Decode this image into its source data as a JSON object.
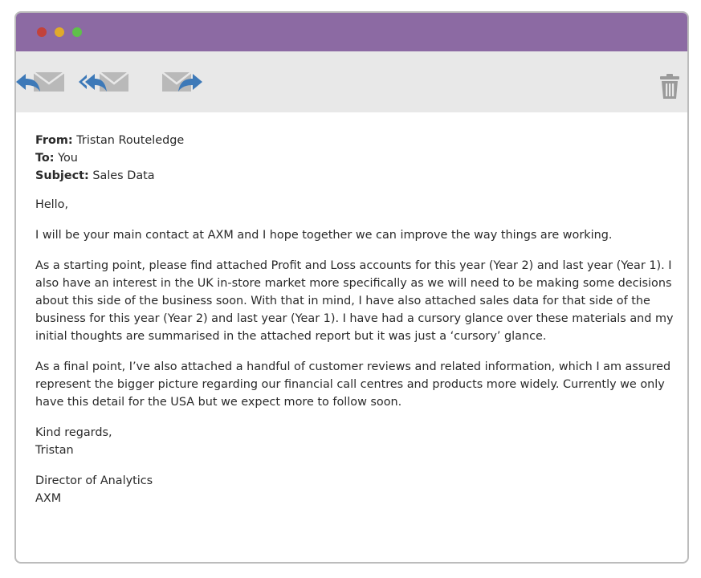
{
  "window": {
    "controls": {
      "close_color": "#c2423b",
      "minimize_color": "#e0aa2b",
      "maximize_color": "#5fc04b"
    },
    "titlebar_color": "#8c6aa3"
  },
  "toolbar": {
    "icons": {
      "reply": "reply-icon",
      "reply_all": "reply-all-icon",
      "forward": "forward-icon",
      "trash": "trash-icon"
    },
    "icon_accent": "#3d79b8",
    "envelope_color": "#b9b9b9"
  },
  "email": {
    "from_label": "From:",
    "from_value": "Tristan Routeledge",
    "to_label": "To:",
    "to_value": "You",
    "subject_label": "Subject:",
    "subject_value": "Sales Data",
    "greeting": "Hello,",
    "paragraphs": [
      "I will be your main contact at AXM and I hope together we can improve the way things are working.",
      "As a starting point, please find attached Profit and Loss accounts for this year (Year 2) and last year (Year 1). I also have an interest in the UK in-store market more specifically as we will need to be making some decisions about this side of the business soon. With that in mind, I have also attached sales data for that side of the business for this year (Year 2) and last year (Year 1). I have had a cursory glance over these materials and my initial thoughts are summarised in the attached report but it was just a ‘cursory’ glance.",
      "As a final point, I’ve also attached a handful of customer reviews and related information, which I am assured represent the bigger picture regarding our financial call centres and products more widely. Currently we only have this detail for the USA but we expect more to follow soon."
    ],
    "closing": "Kind regards,",
    "signature_name": "Tristan",
    "signature_title": "Director of Analytics",
    "signature_company": "AXM"
  }
}
